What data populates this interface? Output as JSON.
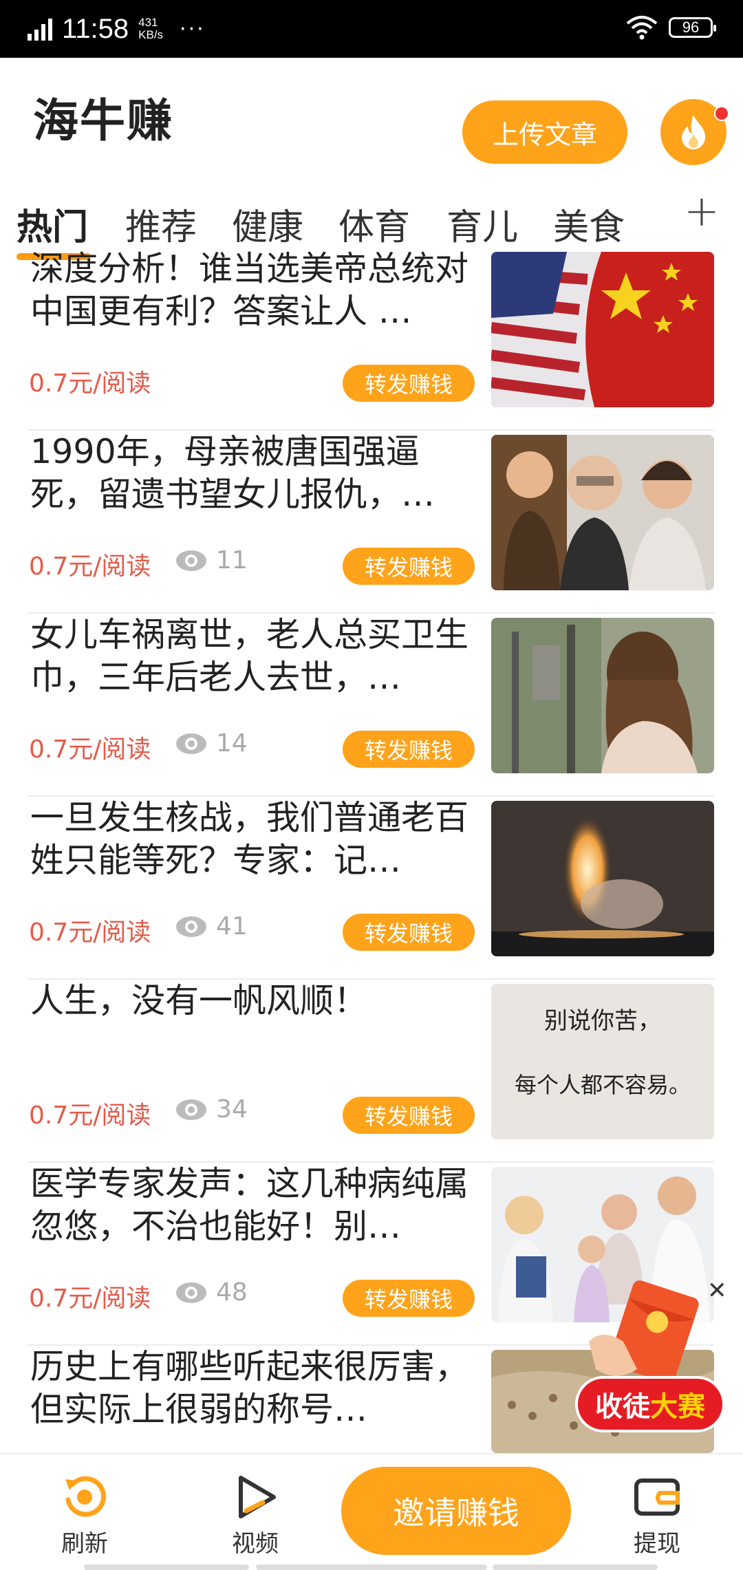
{
  "status_bar": {
    "time": "11:58",
    "speed_value": "431",
    "speed_unit": "KB/s",
    "more": "···",
    "battery": "96"
  },
  "header": {
    "title": "海牛赚",
    "upload_label": "上传文章"
  },
  "tabs": [
    {
      "label": "热门",
      "active": true
    },
    {
      "label": "推荐",
      "active": false
    },
    {
      "label": "健康",
      "active": false
    },
    {
      "label": "体育",
      "active": false
    },
    {
      "label": "育儿",
      "active": false
    },
    {
      "label": "美食",
      "active": false
    }
  ],
  "tab_add": "+",
  "articles": [
    {
      "title": "深度分析！谁当选美帝总统对中国更有利？答案让人 …",
      "price": "0.7元/阅读",
      "views": "",
      "share": "转发赚钱",
      "thumb": "flags"
    },
    {
      "title": "1990年，母亲被唐国强逼死，留遗书望女儿报仇，…",
      "price": "0.7元/阅读",
      "views": "11",
      "share": "转发赚钱",
      "thumb": "people"
    },
    {
      "title": "女儿车祸离世，老人总买卫生巾，三年后老人去世，…",
      "price": "0.7元/阅读",
      "views": "14",
      "share": "转发赚钱",
      "thumb": "woman"
    },
    {
      "title": "一旦发生核战，我们普通老百姓只能等死？专家：记…",
      "price": "0.7元/阅读",
      "views": "41",
      "share": "转发赚钱",
      "thumb": "rocket"
    },
    {
      "title": "人生，没有一帆风顺！",
      "price": "0.7元/阅读",
      "views": "34",
      "share": "转发赚钱",
      "thumb": "calligraphy"
    },
    {
      "title": "医学专家发声：这几种病纯属忽悠，不治也能好！别…",
      "price": "0.7元/阅读",
      "views": "48",
      "share": "转发赚钱",
      "thumb": "doctors"
    },
    {
      "title": "历史上有哪些听起来很厉害，但实际上很弱的称号…",
      "price": "",
      "views": "",
      "share": "",
      "thumb": "painting"
    }
  ],
  "calligraphy_text": {
    "line1": "别说你苦，",
    "line2": "每个人都不容易。"
  },
  "promo": {
    "label_a": "收徒",
    "label_b": "大赛",
    "close": "✕"
  },
  "bottom_nav": {
    "refresh": "刷新",
    "video": "视频",
    "invite": "邀请赚钱",
    "withdraw": "提现"
  },
  "colors": {
    "accent": "#ffa31a",
    "price": "#e45b4a"
  }
}
